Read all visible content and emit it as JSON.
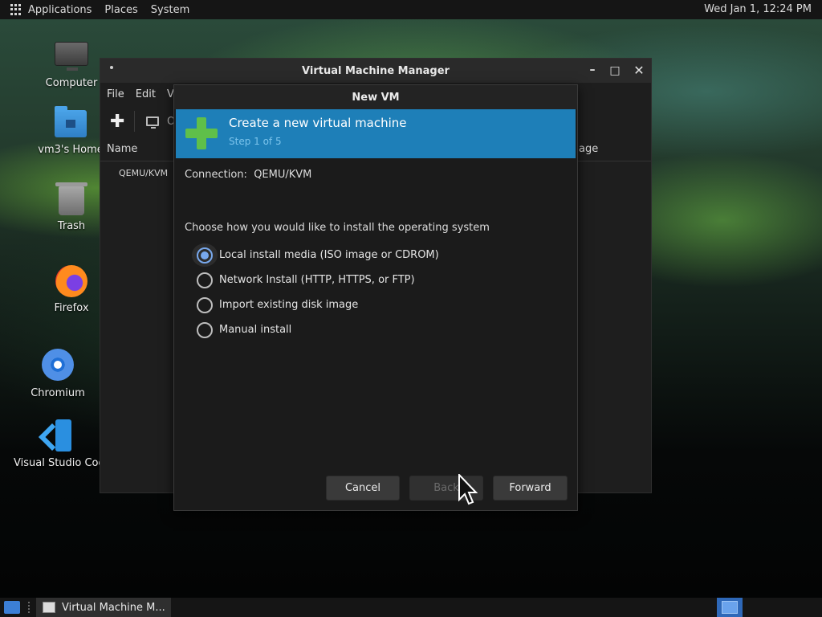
{
  "top_panel": {
    "menus": [
      "Applications",
      "Places",
      "System"
    ],
    "clock": "Wed Jan 1, 12:24 PM"
  },
  "desktop_icons": [
    {
      "label": "Computer",
      "icon": "computer-icon"
    },
    {
      "label": "vm3's Home",
      "icon": "home-folder-icon"
    },
    {
      "label": "Trash",
      "icon": "trash-icon"
    },
    {
      "label": "Firefox",
      "icon": "firefox-icon"
    },
    {
      "label": "Chromium",
      "icon": "chromium-icon"
    },
    {
      "label": "Visual Studio Cod",
      "icon": "vscode-icon"
    }
  ],
  "main_window": {
    "title": "Virtual Machine Manager",
    "menu": [
      "File",
      "Edit",
      "V"
    ],
    "toolbar_partial_label": "O",
    "columns": {
      "name": "Name",
      "right_partial": "age"
    },
    "rows": [
      "QEMU/KVM"
    ]
  },
  "dialog": {
    "title": "New VM",
    "banner_title": "Create a new virtual machine",
    "banner_step": "Step 1 of 5",
    "connection_label": "Connection:",
    "connection_value": "QEMU/KVM",
    "prompt": "Choose how you would like to install the operating system",
    "options": [
      {
        "label": "Local install media (ISO image or CDROM)",
        "checked": true
      },
      {
        "label": "Network Install (HTTP, HTTPS, or FTP)",
        "checked": false
      },
      {
        "label": "Import existing disk image",
        "checked": false
      },
      {
        "label": "Manual install",
        "checked": false
      }
    ],
    "buttons": {
      "cancel": "Cancel",
      "back": "Back",
      "forward": "Forward"
    },
    "accent_color": "#1e7fb8"
  },
  "taskbar": {
    "task_label": "Virtual Machine M..."
  }
}
